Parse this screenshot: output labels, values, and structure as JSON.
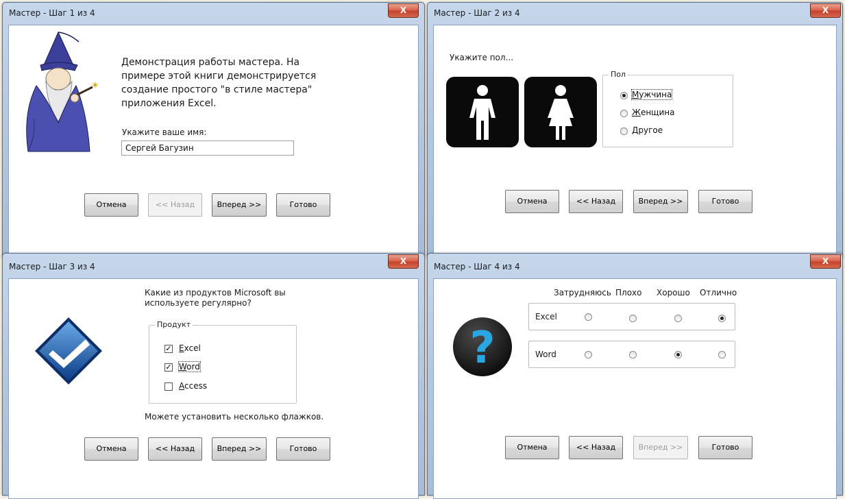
{
  "dialogs": [
    {
      "title": "Мастер -  Шаг 1 из 4",
      "close": "X",
      "intro": [
        "Демонстрация работы мастера. На",
        "примере этой книги демонстрируется",
        "создание простого \"в стиле мастера\"",
        "приложения Excel."
      ],
      "name_label": "Укажите ваше имя:",
      "name_value": "Сергей Багузин",
      "buttons": [
        "Отмена",
        "<< Назад",
        "Вперед >>",
        "Готово"
      ]
    },
    {
      "title": "Мастер -  Шаг 2 из 4",
      "close": "X",
      "prompt": "Укажите пол...",
      "group_title": "Пол",
      "options": [
        {
          "label": "Мужчина",
          "accel": "М",
          "rest": "ужчина",
          "selected": true
        },
        {
          "label": "Женщина",
          "accel": "Ж",
          "rest": "енщина",
          "selected": false
        },
        {
          "label": "Другое",
          "accel": "Д",
          "rest": "ругое",
          "selected": false
        }
      ],
      "buttons": [
        "Отмена",
        "<< Назад",
        "Вперед >>",
        "Готово"
      ]
    },
    {
      "title": "Мастер -  Шаг 3 из 4",
      "close": "X",
      "question": [
        "Какие из продуктов Microsoft вы",
        "используете регулярно?"
      ],
      "group_title": "Продукт",
      "products": [
        {
          "label": "Excel",
          "accel": "E",
          "rest": "xcel",
          "checked": true
        },
        {
          "label": "Word",
          "accel": "W",
          "rest": "ord",
          "checked": true
        },
        {
          "label": "Access",
          "accel": "A",
          "rest": "ccess",
          "checked": false
        }
      ],
      "hint": "Можете установить несколько флажков.",
      "buttons": [
        "Отмена",
        "<< Назад",
        "Вперед >>",
        "Готово"
      ]
    },
    {
      "title": "Мастер -  Шаг 4 из 4",
      "close": "X",
      "columns": [
        "Затрудняюсь",
        "Плохо",
        "Хорошо",
        "Отлично"
      ],
      "rows": [
        {
          "label": "Excel",
          "rating": "Отлично"
        },
        {
          "label": "Word",
          "rating": "Хорошо"
        }
      ],
      "icon_glyph": "?",
      "buttons": [
        "Отмена",
        "<< Назад",
        "Вперед >>",
        "Готово"
      ]
    }
  ],
  "colors": {
    "frame": "#b5c8e0",
    "close_button": "#c4412a",
    "check_icon": "#1a5aa8",
    "question_icon": "#2aa7e0"
  }
}
